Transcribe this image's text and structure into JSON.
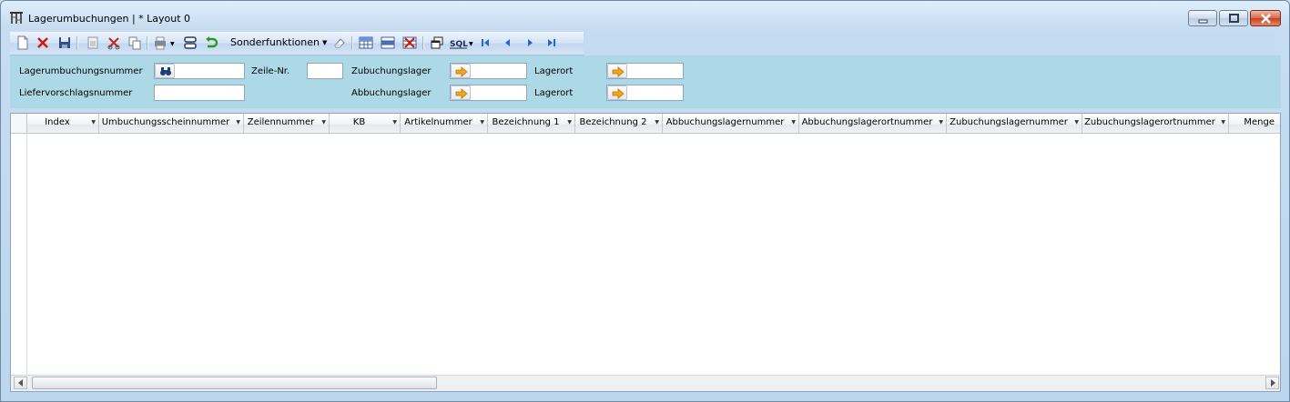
{
  "window": {
    "title": "Lagerumbuchungen | * Layout 0",
    "controls": [
      "minimize-icon",
      "maximize-icon",
      "close-icon"
    ]
  },
  "toolbar": {
    "menu_label": "Sonderfunktionen",
    "icons": [
      "new-document-icon",
      "delete-icon",
      "save-icon",
      "copy-record-icon",
      "cut-icon",
      "copy-icon",
      "print-icon",
      "layout-icon",
      "refresh-icon",
      "eraser-icon",
      "table-icon",
      "table-alt-icon",
      "table-delete-icon",
      "windows-icon",
      "sql-icon",
      "first-record-icon",
      "previous-record-icon",
      "next-record-icon",
      "last-record-icon"
    ],
    "sql_label": "SQL"
  },
  "filter": {
    "lagerumbuchungsnummer_label": "Lagerumbuchungsnummer",
    "liefervorschlagsnummer_label": "Liefervorschlagsnummer",
    "zeile_label": "Zeile-Nr.",
    "zubuchungslager_label": "Zubuchungslager",
    "abbuchungslager_label": "Abbuchungslager",
    "lagerort_label_1": "Lagerort",
    "lagerort_label_2": "Lagerort",
    "lagerumbuchungsnummer_value": "",
    "liefervorschlagsnummer_value": "",
    "zeile_value": "",
    "zubuchungslager_value": "",
    "abbuchungslager_value": "",
    "lagerort_1_value": "",
    "lagerort_2_value": ""
  },
  "grid": {
    "columns": [
      "Index",
      "Umbuchungsscheinnummer",
      "Zeilennummer",
      "KB",
      "Artikelnummer",
      "Bezeichnung 1",
      "Bezeichnung 2",
      "Abbuchungslagernummer",
      "Abbuchungslagerortnummer",
      "Zubuchungslagernummer",
      "Zubuchungslagerortnummer",
      "Menge"
    ],
    "rows": []
  },
  "colors": {
    "filter_background": "#add9e6",
    "window_chrome": "#c7dcf0",
    "close_button": "#c7401e"
  }
}
